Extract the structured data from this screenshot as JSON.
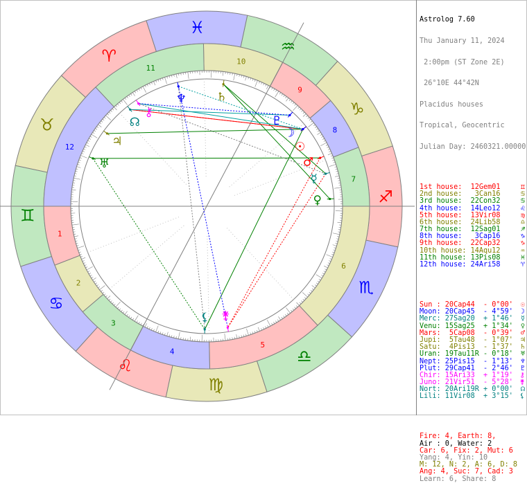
{
  "app": {
    "title": "Astrolog 7.60",
    "date": "Thu January 11, 2024",
    "time": " 2:00pm (ST Zone 2E)",
    "location": " 26°10E 44°42N",
    "house_system": "Placidus houses",
    "zodiac": "Tropical, Geocentric",
    "julian": "Julian Day: 2460321.00000"
  },
  "houses": [
    {
      "text": "1st house:  12Gem01",
      "sym": "♊",
      "color": "#ff0000"
    },
    {
      "text": "2nd house:   3Can16",
      "sym": "♋",
      "color": "#808000"
    },
    {
      "text": "3rd house:  22Con32",
      "sym": "♋",
      "color": "#008000"
    },
    {
      "text": "4th house:  14Leo12",
      "sym": "♌",
      "color": "#0000ff"
    },
    {
      "text": "5th house:  13Vir08",
      "sym": "♍",
      "color": "#ff0000"
    },
    {
      "text": "6th house:  24Lib58",
      "sym": "♎",
      "color": "#808000"
    },
    {
      "text": "7th house:  12Sag01",
      "sym": "♐",
      "color": "#008000"
    },
    {
      "text": "8th house:   3Cap16",
      "sym": "♑",
      "color": "#0000ff"
    },
    {
      "text": "9th house:  22Cap32",
      "sym": "♑",
      "color": "#ff0000"
    },
    {
      "text": "10th house: 14Aqu12",
      "sym": "♒",
      "color": "#808000"
    },
    {
      "text": "11th house: 13Pis08",
      "sym": "♓",
      "color": "#008000"
    },
    {
      "text": "12th house: 24Ari58",
      "sym": "♈",
      "color": "#0000ff"
    }
  ],
  "planets": [
    {
      "text": "Sun : 20Cap44  - 0°00'",
      "sym": "☉",
      "color": "#ff0000"
    },
    {
      "text": "Moon: 20Cap45  - 4°59'",
      "sym": "☽",
      "color": "#0000ff"
    },
    {
      "text": "Merc: 27Sag20  + 1°46'",
      "sym": "☿",
      "color": "#008080"
    },
    {
      "text": "Venu: 15Sag25  + 1°34'",
      "sym": "♀",
      "color": "#008000"
    },
    {
      "text": "Mars:  5Cap08  - 0°39'",
      "sym": "♂",
      "color": "#ff0000"
    },
    {
      "text": "Jupi:  5Tau48  - 1°07'",
      "sym": "♃",
      "color": "#808000"
    },
    {
      "text": "Satu:  4Pis13  - 1°37'",
      "sym": "♄",
      "color": "#808000"
    },
    {
      "text": "Uran: 19Tau11R - 0°18'",
      "sym": "♅",
      "color": "#008000"
    },
    {
      "text": "Nept: 25Pis15  - 1°13'",
      "sym": "♆",
      "color": "#0000ff"
    },
    {
      "text": "Plut: 29Cap41  - 2°46'",
      "sym": "♇",
      "color": "#0000ff"
    },
    {
      "text": "Chir: 15Ari33  + 1°19'",
      "sym": "⚷",
      "color": "#ff00ff"
    },
    {
      "text": "Juno: 21Vir51  - 5°28'",
      "sym": "⚵",
      "color": "#ff00ff"
    },
    {
      "text": "Nort: 20Ari19R + 0°00'",
      "sym": "☊",
      "color": "#008080"
    },
    {
      "text": "Lili: 11Vir08  + 3°15'",
      "sym": "⚸",
      "color": "#008080"
    }
  ],
  "stats": [
    {
      "text": "Fire: 4, Earth: 8,",
      "color": "#ff0000"
    },
    {
      "text": "Air : 0, Water: 2",
      "color": "#000000"
    },
    {
      "text": "Car: 6, Fix: 2, Mut: 6",
      "color": "#ff0000"
    },
    {
      "text": "Yang: 4, Yin: 10",
      "color": "#808080"
    },
    {
      "text": "M: 12, N: 2, A: 6, D: 8",
      "color": "#808000"
    },
    {
      "text": "Ang: 4, Suc: 7, Cad: 3",
      "color": "#ff0000"
    },
    {
      "text": "Learn: 6, Share: 8",
      "color": "#808080"
    }
  ],
  "wheel": {
    "asc_lon": 72.02,
    "sign_glyphs": [
      "♈",
      "♉",
      "♊",
      "♋",
      "♌",
      "♍",
      "♎",
      "♏",
      "♐",
      "♑",
      "♒",
      "♓"
    ],
    "sign_fills": [
      "#ffc0c0",
      "#e8e8b8",
      "#c0e8c0",
      "#c0c0ff",
      "#ffc0c0",
      "#e8e8b8",
      "#c0e8c0",
      "#c0c0ff",
      "#ffc0c0",
      "#e8e8b8",
      "#c0e8c0",
      "#c0c0ff"
    ],
    "sign_text": [
      "#ff0000",
      "#808000",
      "#008000",
      "#0000ff",
      "#ff0000",
      "#808000",
      "#008000",
      "#0000ff",
      "#ff0000",
      "#808000",
      "#008000",
      "#0000ff"
    ],
    "house_cusps": [
      72.02,
      93.27,
      112.53,
      134.2,
      163.13,
      204.97,
      252.02,
      273.27,
      292.53,
      314.2,
      343.13,
      24.97
    ],
    "house_labels": [
      "1",
      "2",
      "3",
      "4",
      "5",
      "6",
      "7",
      "8",
      "9",
      "10",
      "11",
      "12"
    ],
    "planet_list": [
      {
        "name": "Sun",
        "lon": 290.73,
        "glyph": "☉",
        "color": "#ff0000"
      },
      {
        "name": "Moon",
        "lon": 290.75,
        "glyph": "☽",
        "color": "#0000ff"
      },
      {
        "name": "Mercury",
        "lon": 267.33,
        "glyph": "☿",
        "color": "#008080"
      },
      {
        "name": "Venus",
        "lon": 255.42,
        "glyph": "♀",
        "color": "#008000"
      },
      {
        "name": "Mars",
        "lon": 275.13,
        "glyph": "♂",
        "color": "#ff0000"
      },
      {
        "name": "Jupiter",
        "lon": 35.8,
        "glyph": "♃",
        "color": "#808000"
      },
      {
        "name": "Saturn",
        "lon": 334.22,
        "glyph": "♄",
        "color": "#808000"
      },
      {
        "name": "Uranus",
        "lon": 49.18,
        "glyph": "♅",
        "color": "#008000"
      },
      {
        "name": "Neptune",
        "lon": 355.25,
        "glyph": "♆",
        "color": "#0000ff"
      },
      {
        "name": "Pluto",
        "lon": 299.68,
        "glyph": "♇",
        "color": "#0000ff"
      },
      {
        "name": "Chiron",
        "lon": 15.55,
        "glyph": "⚷",
        "color": "#ff00ff"
      },
      {
        "name": "Juno",
        "lon": 171.85,
        "glyph": "⚵",
        "color": "#ff00ff"
      },
      {
        "name": "North Node",
        "lon": 20.32,
        "glyph": "☊",
        "color": "#008080"
      },
      {
        "name": "Lilith",
        "lon": 161.13,
        "glyph": "⚸",
        "color": "#008080"
      }
    ],
    "aspect_lines": [
      {
        "a": "Sun",
        "b": "Jupiter",
        "color": "#008000",
        "dash": false
      },
      {
        "a": "Mercury",
        "b": "Saturn",
        "color": "#008000",
        "dash": false
      },
      {
        "a": "Venus",
        "b": "Saturn",
        "color": "#008000",
        "dash": false
      },
      {
        "a": "Mars",
        "b": "Uranus",
        "color": "#008000",
        "dash": false
      },
      {
        "a": "Sun",
        "b": "Lilith",
        "color": "#008000",
        "dash": false
      },
      {
        "a": "Sun",
        "b": "North Node",
        "color": "#ff0000",
        "dash": false
      },
      {
        "a": "Moon",
        "b": "North Node",
        "color": "#ff0000",
        "dash": true
      },
      {
        "a": "Moon",
        "b": "Chiron",
        "color": "#00a0a0",
        "dash": false
      },
      {
        "a": "Pluto",
        "b": "North Node",
        "color": "#00a0a0",
        "dash": false
      },
      {
        "a": "Mars",
        "b": "Juno",
        "color": "#ff0000",
        "dash": true
      },
      {
        "a": "Mercury",
        "b": "Juno",
        "color": "#ff0000",
        "dash": true
      },
      {
        "a": "Sun",
        "b": "Neptune",
        "color": "#00a0a0",
        "dash": true
      },
      {
        "a": "Pluto",
        "b": "Chiron",
        "color": "#0000ff",
        "dash": true
      },
      {
        "a": "Neptune",
        "b": "Juno",
        "color": "#0000ff",
        "dash": true
      },
      {
        "a": "Neptune",
        "b": "Lilith",
        "color": "#808080",
        "dash": true
      },
      {
        "a": "Uranus",
        "b": "Lilith",
        "color": "#008000",
        "dash": true
      },
      {
        "a": "Mercury",
        "b": "Chiron",
        "color": "#808080",
        "dash": true
      }
    ]
  }
}
